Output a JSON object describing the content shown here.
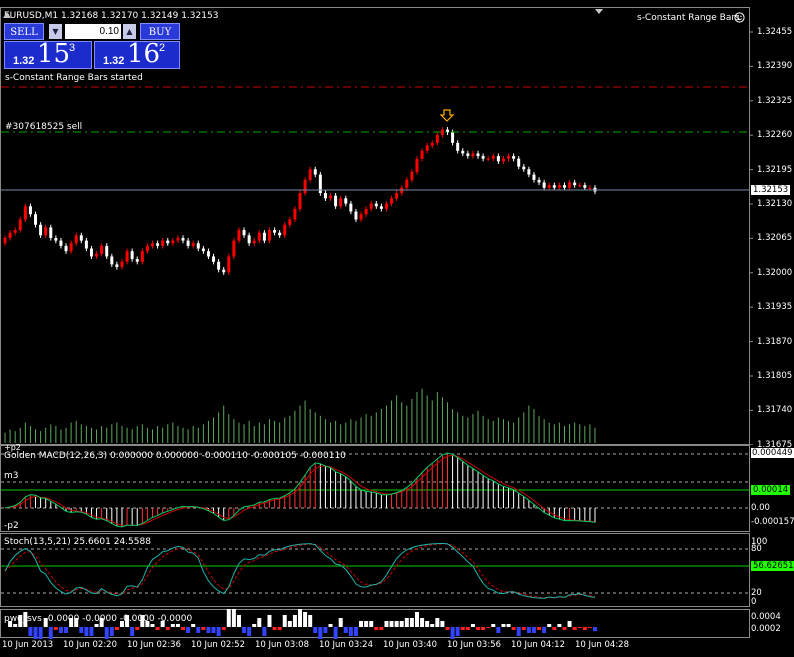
{
  "header": {
    "symbol_line": "EURUSD,M1  1.32168 1.32170 1.32149 1.32153",
    "indicator_name": "s-Constant Range Bars",
    "started_msg": "s-Constant Range Bars started",
    "order_label": "#307618525 sell"
  },
  "trade_panel": {
    "sell_label": "SELL",
    "buy_label": "BUY",
    "lot_value": "0.10",
    "sell_small": "1.32",
    "sell_big": "15",
    "sell_sup": "3",
    "buy_small": "1.32",
    "buy_big": "16",
    "buy_sup": "2"
  },
  "price_axis": [
    "1.32455",
    "1.32390",
    "1.32325",
    "1.32260",
    "1.32195",
    "1.32130",
    "1.32065",
    "1.32000",
    "1.31935",
    "1.31870",
    "1.31805",
    "1.31740",
    "1.31675"
  ],
  "current_price": "1.32153",
  "macd": {
    "title": "Golden MACD(12,26,3) 0.000000 0.000000 -0.000110 -0.000105 -0.000110",
    "label_m3": "m3",
    "label_p2": "-p2",
    "axis": [
      "0.000449",
      "0.00",
      "-0.000157"
    ],
    "badge": "0.00014",
    "extra_top": "+p2"
  },
  "stoch": {
    "title": "Stoch(13,5,21) 25.6601 24.5588",
    "axis": [
      "80",
      "20",
      "0"
    ],
    "axis_top": "100",
    "badge": "56.62651"
  },
  "pwo": {
    "title": "pwo_svs -0.0000 -0.0000 -0.0000 -0.0000",
    "axis": [
      "0.0004",
      "0.0002"
    ]
  },
  "time_axis": [
    "10 Jun 2013",
    "10 Jun 02:20",
    "10 Jun 02:36",
    "10 Jun 02:52",
    "10 Jun 03:08",
    "10 Jun 03:24",
    "10 Jun 03:40",
    "10 Jun 03:56",
    "10 Jun 04:12",
    "10 Jun 04:28"
  ],
  "colors": {
    "bull": "#ff0000",
    "bear": "#ffffff",
    "volume": "#5fa85f",
    "grid": "#777777",
    "badge_green": "#22ff00",
    "level_green": "#00cc00"
  },
  "icons": {
    "arrow": "sell-arrow-icon",
    "smile": "smiley-icon",
    "menu": "triangle-menu-icon"
  },
  "chart_data": {
    "type": "candlestick",
    "title": "",
    "y_range": [
      1.31675,
      1.3247
    ],
    "current_price": 1.32153,
    "closes": [
      1.32065,
      1.32075,
      1.3208,
      1.321,
      1.32125,
      1.3211,
      1.3209,
      1.3207,
      1.32085,
      1.32065,
      1.3206,
      1.3205,
      1.3204,
      1.32055,
      1.3207,
      1.3206,
      1.32045,
      1.3203,
      1.32035,
      1.3205,
      1.3203,
      1.32015,
      1.3201,
      1.3202,
      1.3204,
      1.32025,
      1.3202,
      1.3204,
      1.3205,
      1.32055,
      1.3205,
      1.3206,
      1.32055,
      1.3206,
      1.32065,
      1.3206,
      1.3205,
      1.32055,
      1.32045,
      1.3204,
      1.3203,
      1.3202,
      1.32005,
      1.32,
      1.3203,
      1.3206,
      1.3208,
      1.3207,
      1.32055,
      1.3206,
      1.32075,
      1.3206,
      1.3208,
      1.32075,
      1.3207,
      1.3209,
      1.321,
      1.3212,
      1.3215,
      1.32175,
      1.32195,
      1.32185,
      1.3215,
      1.3214,
      1.32145,
      1.32125,
      1.3214,
      1.3213,
      1.32115,
      1.321,
      1.3211,
      1.3212,
      1.3213,
      1.32125,
      1.3212,
      1.3213,
      1.3214,
      1.3215,
      1.3216,
      1.32175,
      1.3219,
      1.32215,
      1.3223,
      1.3224,
      1.32245,
      1.3226,
      1.3227,
      1.32265,
      1.32245,
      1.3223,
      1.32225,
      1.3222,
      1.32225,
      1.3222,
      1.32215,
      1.32215,
      1.3222,
      1.3221,
      1.32215,
      1.3222,
      1.32215,
      1.322,
      1.32195,
      1.32185,
      1.32175,
      1.3217,
      1.3216,
      1.32165,
      1.3216,
      1.32165,
      1.3216,
      1.3217,
      1.32165,
      1.32165,
      1.3216,
      1.3216,
      1.32153
    ],
    "volume": [
      6,
      8,
      7,
      9,
      12,
      10,
      8,
      7,
      9,
      11,
      10,
      8,
      9,
      12,
      13,
      11,
      10,
      9,
      8,
      10,
      9,
      11,
      12,
      10,
      9,
      8,
      10,
      11,
      9,
      8,
      10,
      9,
      11,
      12,
      10,
      9,
      8,
      10,
      9,
      11,
      13,
      15,
      18,
      22,
      17,
      14,
      12,
      11,
      13,
      10,
      12,
      11,
      14,
      13,
      12,
      15,
      16,
      19,
      22,
      25,
      20,
      18,
      16,
      14,
      12,
      13,
      11,
      12,
      14,
      13,
      15,
      17,
      16,
      18,
      20,
      22,
      25,
      28,
      24,
      22,
      26,
      30,
      32,
      28,
      25,
      30,
      27,
      24,
      20,
      18,
      16,
      15,
      17,
      19,
      16,
      14,
      13,
      15,
      14,
      13,
      12,
      15,
      18,
      22,
      20,
      16,
      14,
      12,
      11,
      12,
      10,
      11,
      12,
      11,
      10,
      11,
      9
    ]
  }
}
